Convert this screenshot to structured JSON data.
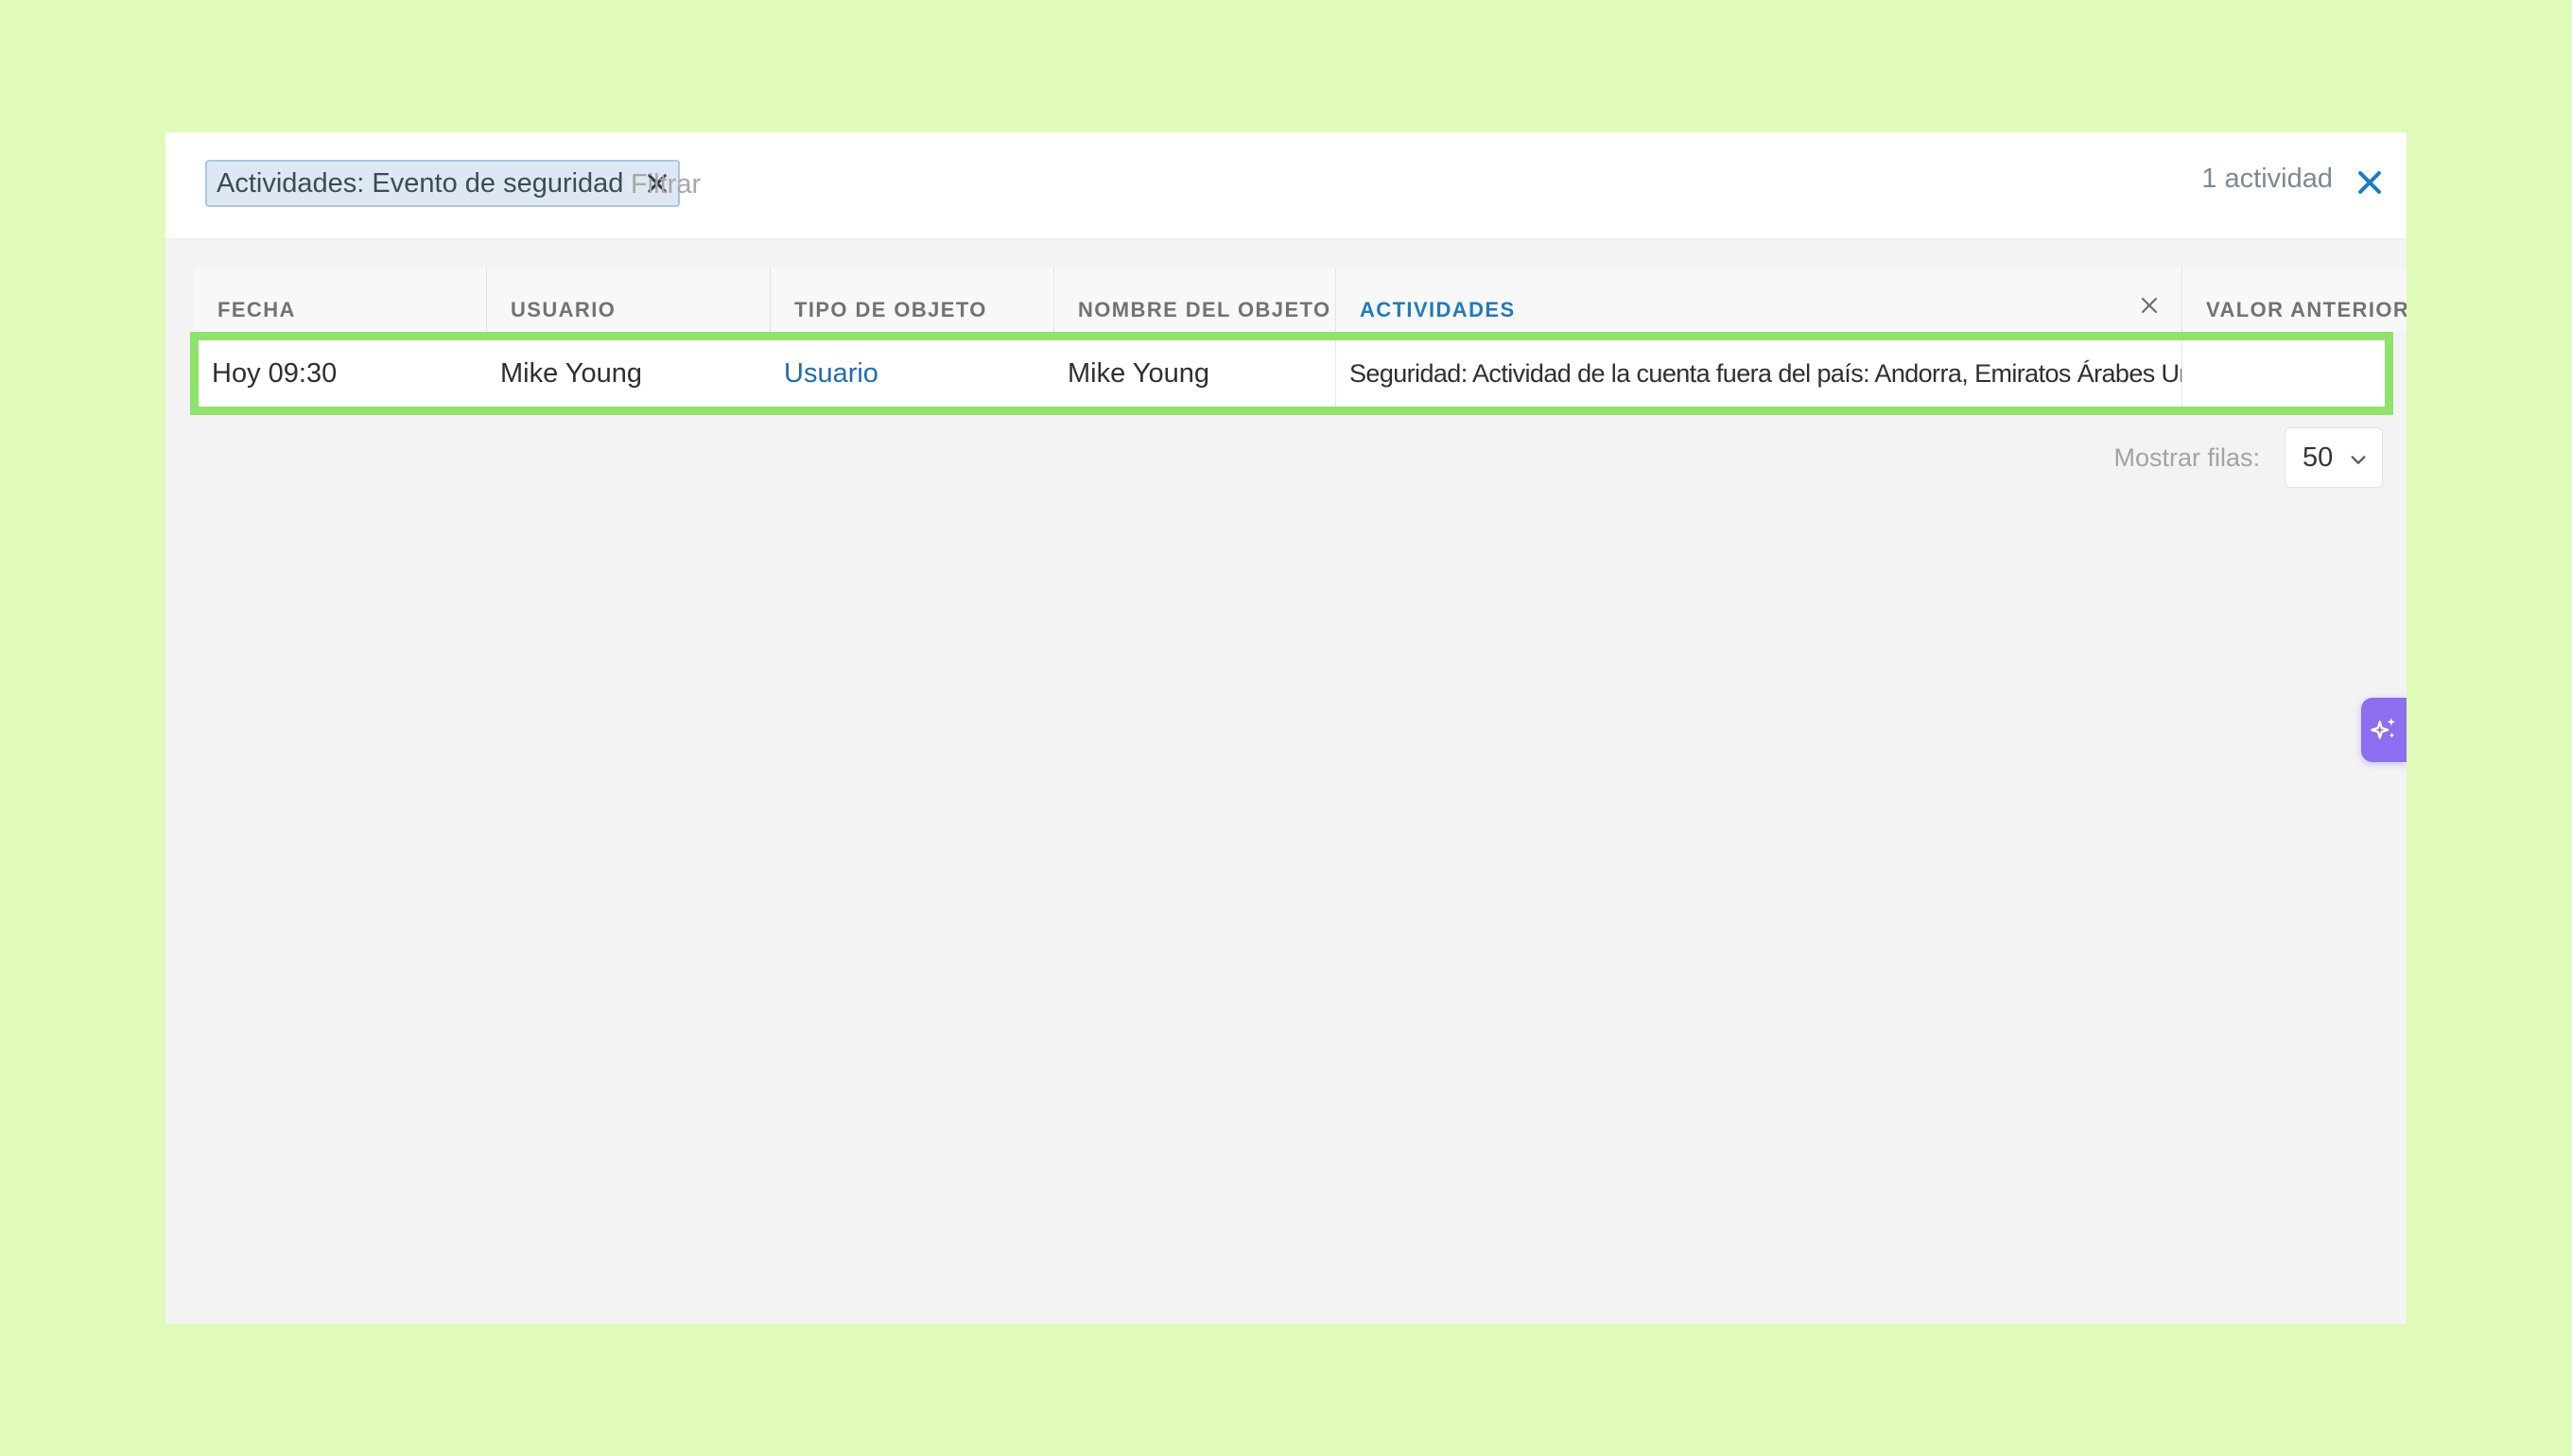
{
  "filter_bar": {
    "chip_label": "Actividades: Evento de seguridad",
    "search_placeholder": "Filtrar",
    "result_count": "1 actividad"
  },
  "table": {
    "columns": [
      "FECHA",
      "USUARIO",
      "TIPO DE OBJETO",
      "NOMBRE DEL OBJETO",
      "ACTIVIDADES",
      "VALOR ANTERIOR"
    ],
    "active_column": "ACTIVIDADES",
    "rows": [
      {
        "fecha": "Hoy 09:30",
        "usuario": "Mike Young",
        "tipo_de_objeto": "Usuario",
        "nombre_del_objeto": "Mike Young",
        "actividades": "Seguridad: Actividad de la cuenta fuera del país: Andorra, Emiratos Árabes Unidos",
        "valor_anterior": ""
      }
    ]
  },
  "pagination": {
    "rows_label": "Mostrar filas:",
    "rows_value": "50"
  },
  "icons": {
    "chip_close": "close-icon",
    "clear_all": "close-icon",
    "column_close": "close-icon",
    "rows_dropdown": "chevron-down-icon",
    "ai_assistant": "sparkles-icon"
  },
  "colors": {
    "page_background": "#e0fab9",
    "highlight_border": "#8fe36a",
    "accent_blue": "#1d7bc1",
    "ai_button": "#8d6df0"
  }
}
